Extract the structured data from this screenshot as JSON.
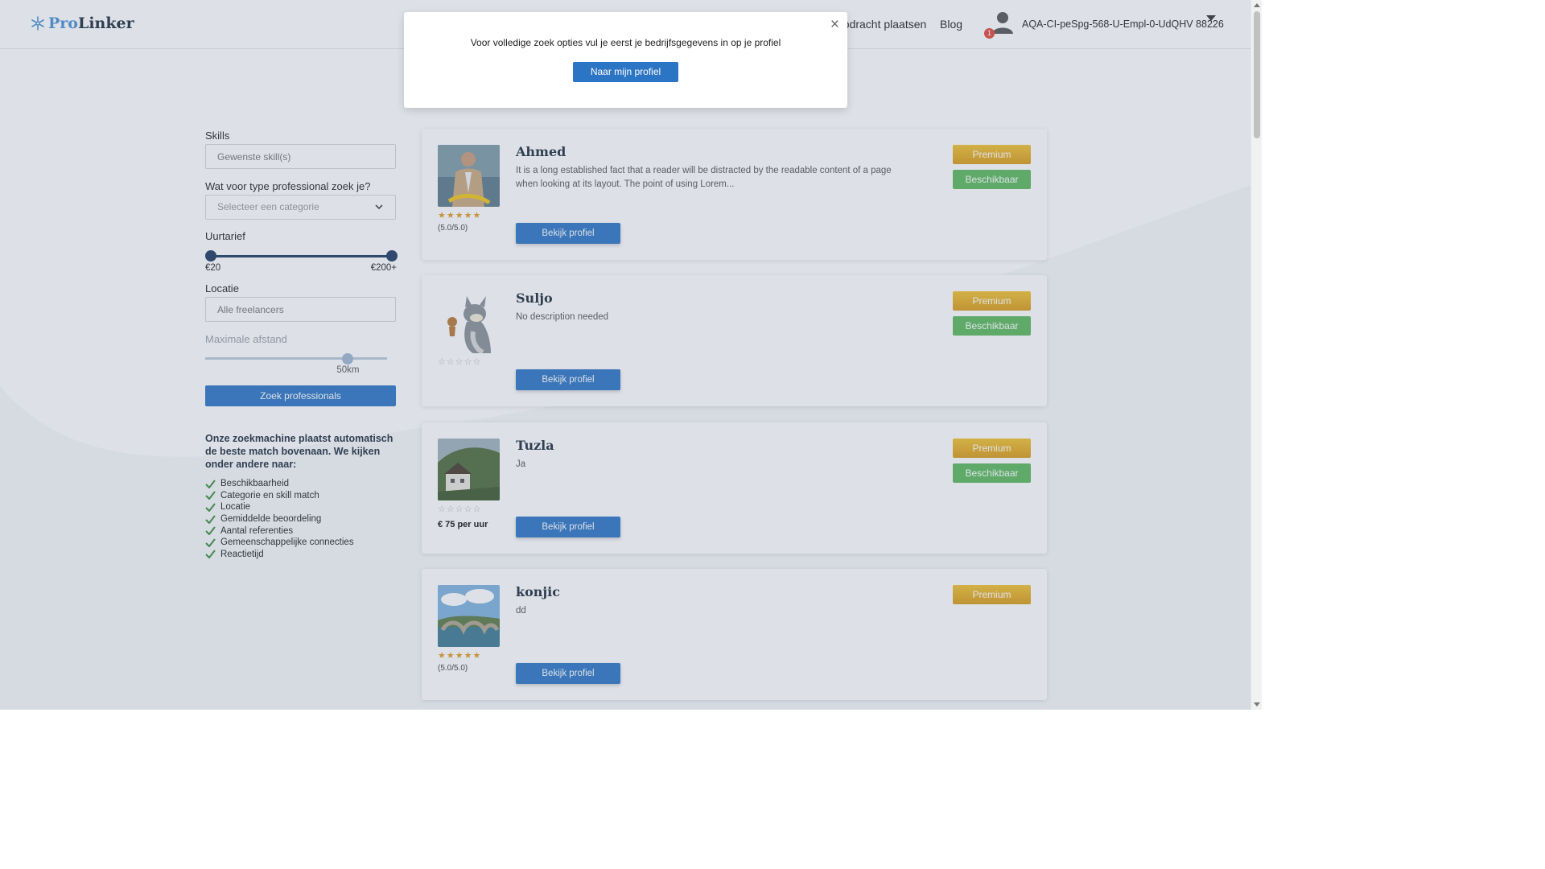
{
  "header": {
    "logo_pro": "Pro",
    "logo_linker": "Linker",
    "nav_opdracht": "opdracht plaatsen",
    "nav_blog": "Blog",
    "notification_count": "1",
    "username": "AQA-CI-peSpg-568-U-Empl-0-UdQHV 88226"
  },
  "sidebar": {
    "skills_label": "Skills",
    "skills_placeholder": "Gewenste skill(s)",
    "type_label": "Wat voor type professional zoek je?",
    "type_placeholder": "Selecteer een categorie",
    "rate_label": "Uurtarief",
    "rate_min": "€20",
    "rate_max": "€200+",
    "location_label": "Locatie",
    "location_placeholder": "Alle freelancers",
    "distance_label": "Maximale afstand",
    "distance_value": "50km",
    "distance_fraction": 0.4,
    "search_button": "Zoek professionals",
    "info_title": "Onze zoekmachine plaatst automatisch de beste match bovenaan. We kijken onder andere naar:",
    "criteria": [
      "Beschikbaarheid",
      "Categorie en skill match",
      "Locatie",
      "Gemiddelde beoordeling",
      "Aantal referenties",
      "Gemeenschappelijke connecties",
      "Reactietijd"
    ]
  },
  "cards": [
    {
      "name": "Ahmed",
      "description": "It is a long established fact that a reader will be distracted by the readable content of a page when looking at its layout. The point of using Lorem...",
      "rating_text": "(5.0/5.0)",
      "stars": 5,
      "view_button": "Bekijk profiel",
      "premium": "Premium",
      "available": "Beschikbaar"
    },
    {
      "name": "Suljo",
      "description": "No description needed",
      "stars": 0,
      "view_button": "Bekijk profiel",
      "premium": "Premium",
      "available": "Beschikbaar"
    },
    {
      "name": "Tuzla",
      "description": "Ja",
      "stars": 0,
      "rate": "€ 75 per uur",
      "view_button": "Bekijk profiel",
      "premium": "Premium",
      "available": "Beschikbaar"
    },
    {
      "name": "konjic",
      "description": "dd",
      "rating_text": "(5.0/5.0)",
      "stars": 5,
      "view_button": "Bekijk profiel",
      "premium": "Premium"
    }
  ],
  "modal": {
    "message": "Voor volledige zoek opties vul je eerst je bedrijfsgegevens in op je profiel",
    "button": "Naar mijn profiel",
    "close_symbol": "×"
  },
  "colors": {
    "primary": "#2c74c4",
    "navy": "#1e3a5f",
    "premium": "#e4ad22",
    "available": "#5cb85c",
    "star": "#e29a1f"
  }
}
